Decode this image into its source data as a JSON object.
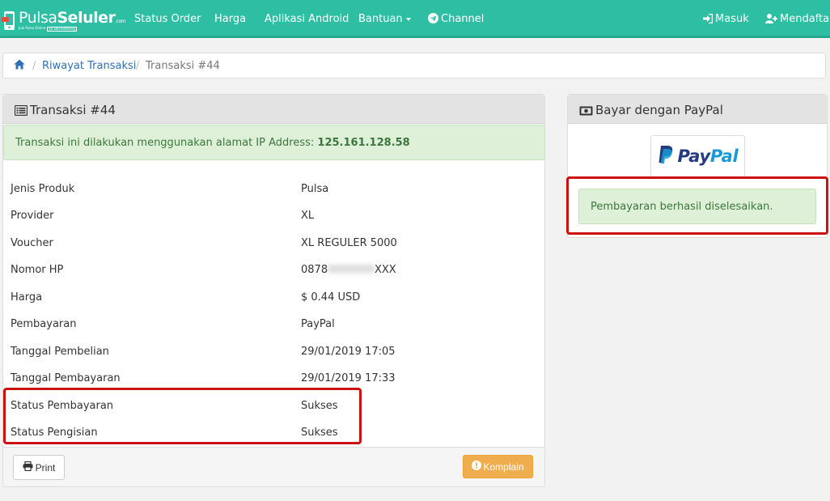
{
  "brand": {
    "name_part1": "Pulsa",
    "name_part2": "Seluler",
    "name_suffix": ".com",
    "tagline_left": "Jual Pulsa Online",
    "tagline_right": "ya ada memang"
  },
  "nav": {
    "items": [
      {
        "label": "Status Order"
      },
      {
        "label": "Harga"
      },
      {
        "label": "Aplikasi Android"
      },
      {
        "label": "Bantuan"
      },
      {
        "label": "Channel",
        "icon": "telegram-icon"
      }
    ],
    "right": [
      {
        "label": "Masuk",
        "icon": "sign-in-icon"
      },
      {
        "label": "Mendaftar",
        "icon": "user-plus-icon"
      }
    ]
  },
  "breadcrumb": {
    "home_icon": "home-icon",
    "separator": "/",
    "items": [
      {
        "label": "Riwayat Transaksi"
      },
      {
        "label": "Transaksi #44"
      }
    ]
  },
  "transaction": {
    "title": "Transaksi #44",
    "title_icon": "list-alt-icon",
    "ip_notice": "Transaksi ini dilakukan menggunakan alamat IP Address:",
    "ip_address": "125.161.128.58",
    "details": [
      {
        "label": "Jenis Produk",
        "value": "Pulsa"
      },
      {
        "label": "Provider",
        "value": "XL"
      },
      {
        "label": "Voucher",
        "value": "XL REGULER 5000"
      },
      {
        "label": "Nomor HP",
        "value_prefix": "0878",
        "value_masked": "0000000",
        "value_suffix": "XXX"
      },
      {
        "label": "Harga",
        "value": "$ 0.44 USD"
      },
      {
        "label": "Pembayaran",
        "value": "PayPal"
      },
      {
        "label": "Tanggal Pembelian",
        "value": "29/01/2019 17:05"
      },
      {
        "label": "Tanggal Pembayaran",
        "value": "29/01/2019 17:33"
      },
      {
        "label": "Status Pembayaran",
        "value": "Sukses"
      },
      {
        "label": "Status Pengisian",
        "value": "Sukses"
      }
    ],
    "print_label": "Print",
    "komplain_label": "Komplain"
  },
  "paypal": {
    "title": "Bayar dengan PayPal",
    "title_icon": "money-icon",
    "logo_text_pay": "Pay",
    "logo_text_pal": "Pal",
    "success_message": "Pembayaran berhasil diselesaikan."
  },
  "colors": {
    "navbar": "#2dbea4",
    "success_bg": "#dff0d8",
    "success_text": "#3c763d",
    "warning": "#f0ad4e",
    "link": "#2f6fb4",
    "highlight": "#cc1111"
  }
}
